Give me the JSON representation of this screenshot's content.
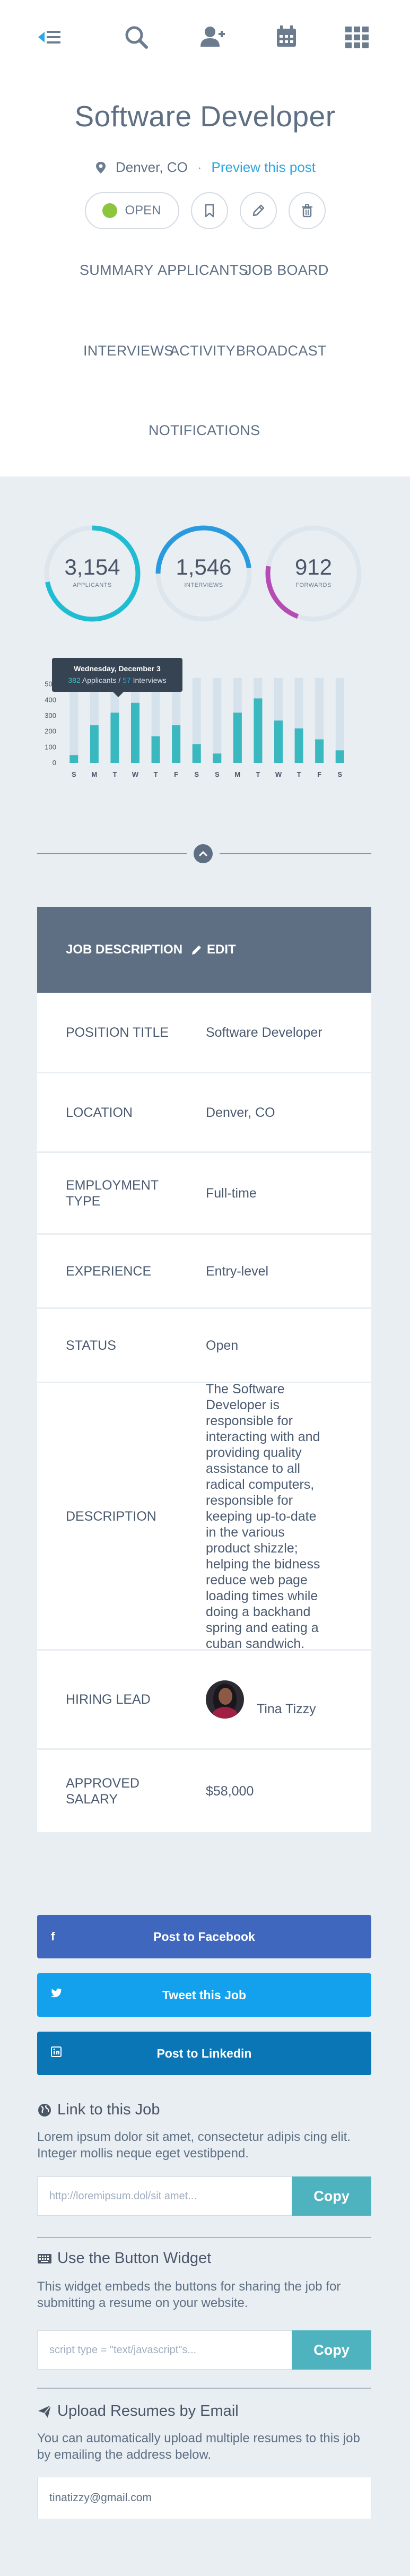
{
  "nav": {
    "icons": [
      "menu-back-icon",
      "search-icon",
      "add-user-icon",
      "calendar-icon",
      "grid-icon"
    ]
  },
  "job": {
    "title": "Software Developer",
    "location": "Denver, CO",
    "separator": "·",
    "preview_label": "Preview this post",
    "status_label": "OPEN"
  },
  "tabs": {
    "summary": "SUMMARY",
    "applicants": "APPLICANTS",
    "job_board": "JOB BOARD",
    "interviews": "INTERVIEWS",
    "activity": "ACTIVITY",
    "broadcast": "BROADCAST",
    "notifications": "NOTIFICATIONS"
  },
  "stats": {
    "applicants": {
      "value": "3,154",
      "label": "APPLICANTS",
      "fill": 0.72,
      "color": "#1fbcd2"
    },
    "interviews": {
      "value": "1,546",
      "label": "INTERVIEWS",
      "fill": 0.48,
      "color": "#2a9ae0"
    },
    "forwards": {
      "value": "912",
      "label": "FORWARDS",
      "fill": 0.22,
      "color": "#b54bb3"
    }
  },
  "chart_data": {
    "type": "bar",
    "categories": [
      "S",
      "M",
      "T",
      "W",
      "T",
      "F",
      "S",
      "S",
      "M",
      "T",
      "W",
      "T",
      "F",
      "S"
    ],
    "ylim": [
      0,
      600
    ],
    "yticks": [
      0,
      100,
      200,
      300,
      400,
      500
    ],
    "series": [
      {
        "name": "Applicants",
        "values": [
          50,
          240,
          320,
          382,
          170,
          240,
          120,
          60,
          320,
          410,
          270,
          220,
          150,
          80
        ],
        "color": "#39b8c0"
      },
      {
        "name": "Background",
        "values": [
          540,
          540,
          540,
          540,
          540,
          540,
          540,
          540,
          540,
          540,
          540,
          540,
          540,
          540
        ],
        "color": "#d6e2eb"
      }
    ],
    "tooltip": {
      "date": "Wednesday, December 3",
      "applicants": "382",
      "applicants_label": "Applicants",
      "sep": "/",
      "interviews": "57",
      "interviews_label": "Interviews"
    }
  },
  "table": {
    "header_left": "JOB DESCRIPTION",
    "header_edit": "EDIT",
    "rows": [
      {
        "label": "POSITION TITLE",
        "value": "Software Developer"
      },
      {
        "label": "LOCATION",
        "value": "Denver, CO"
      },
      {
        "label": "EMPLOYMENT TYPE",
        "value": "Full-time"
      },
      {
        "label": "EXPERIENCE",
        "value": "Entry-level"
      },
      {
        "label": "STATUS",
        "value": "Open"
      },
      {
        "label": "DESCRIPTION",
        "value": "The Software Developer is responsible for interacting with and providing quality assistance to all radical computers, responsible for keeping up-to-date in the various product shizzle; helping the bidness reduce web page loading times while doing a backhand spring and eating a cuban sandwich."
      },
      {
        "label": "HIRING LEAD",
        "value": "Tina Tizzy"
      },
      {
        "label": "APPROVED SALARY",
        "value": "$58,000"
      }
    ]
  },
  "share": {
    "facebook": "Post to Facebook",
    "twitter": "Tweet this Job",
    "linkedin": "Post to Linkedin"
  },
  "link_section": {
    "title": "Link to this Job",
    "text": "Lorem ipsum dolor sit amet, consectetur adipis cing elit. Integer mollis neque eget vestibpend.",
    "input_value": "http://loremipsum.dol/sit amet...",
    "copy_label": "Copy"
  },
  "widget_section": {
    "title": "Use the Button Widget",
    "text": "This widget embeds the buttons for sharing the job for submitting a resume on your website.",
    "input_value": "script type = \"text/javascript\"s...",
    "copy_label": "Copy"
  },
  "email_section": {
    "title": "Upload Resumes by Email",
    "text": "You can automatically upload multiple resumes to this job by emailing the address below.",
    "email": "tinatizzy@gmail.com"
  }
}
